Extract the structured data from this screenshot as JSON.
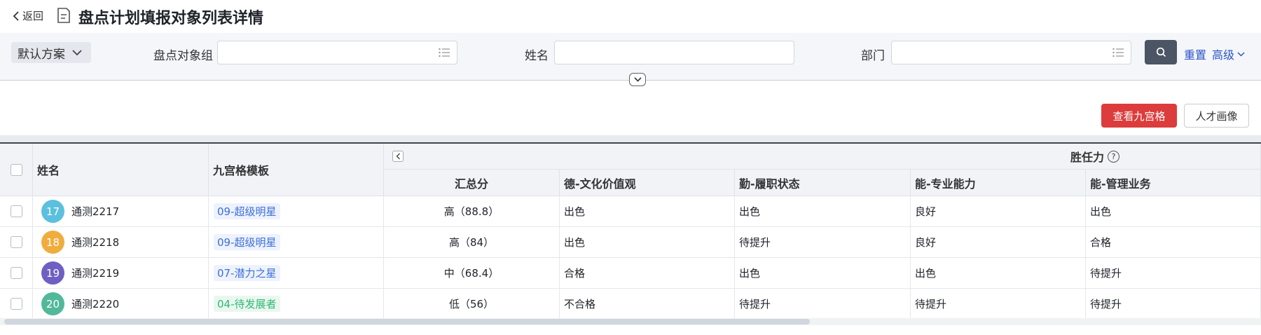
{
  "header": {
    "back_label": "返回",
    "title": "盘点计划填报对象列表详情"
  },
  "filters": {
    "scheme_label": "默认方案",
    "group_label": "盘点对象组",
    "group_value": "",
    "name_label": "姓名",
    "name_value": "",
    "dept_label": "部门",
    "dept_value": "",
    "reset_label": "重置",
    "advanced_label": "高级"
  },
  "actions": {
    "view_grid_label": "查看九宫格",
    "talent_portrait_label": "人才画像"
  },
  "table": {
    "headers": {
      "name": "姓名",
      "template": "九宫格模板",
      "group": "胜任力",
      "total": "汇总分",
      "de": "德-文化价值观",
      "qin": "勤-履职状态",
      "neng_pro": "能-专业能力",
      "neng_mgmt": "能-管理业务"
    },
    "rows": [
      {
        "avatar": "17",
        "avatar_color": "#5bc0de",
        "name": "通测2217",
        "template": "09-超级明星",
        "template_style": "blue",
        "total": "高（88.8）",
        "de": "出色",
        "qin": "出色",
        "neng_pro": "良好",
        "neng_mgmt": "出色"
      },
      {
        "avatar": "18",
        "avatar_color": "#f0ad3e",
        "name": "通测2218",
        "template": "09-超级明星",
        "template_style": "blue",
        "total": "高（84）",
        "de": "出色",
        "qin": "待提升",
        "neng_pro": "良好",
        "neng_mgmt": "合格"
      },
      {
        "avatar": "19",
        "avatar_color": "#6f5fc2",
        "name": "通测2219",
        "template": "07-潜力之星",
        "template_style": "blue",
        "total": "中（68.4）",
        "de": "合格",
        "qin": "出色",
        "neng_pro": "出色",
        "neng_mgmt": "待提升"
      },
      {
        "avatar": "20",
        "avatar_color": "#52b89a",
        "name": "通测2220",
        "template": "04-待发展者",
        "template_style": "green",
        "total": "低（56）",
        "de": "不合格",
        "qin": "待提升",
        "neng_pro": "待提升",
        "neng_mgmt": "待提升"
      }
    ]
  },
  "scroll": {
    "horizontal_position": 0
  }
}
